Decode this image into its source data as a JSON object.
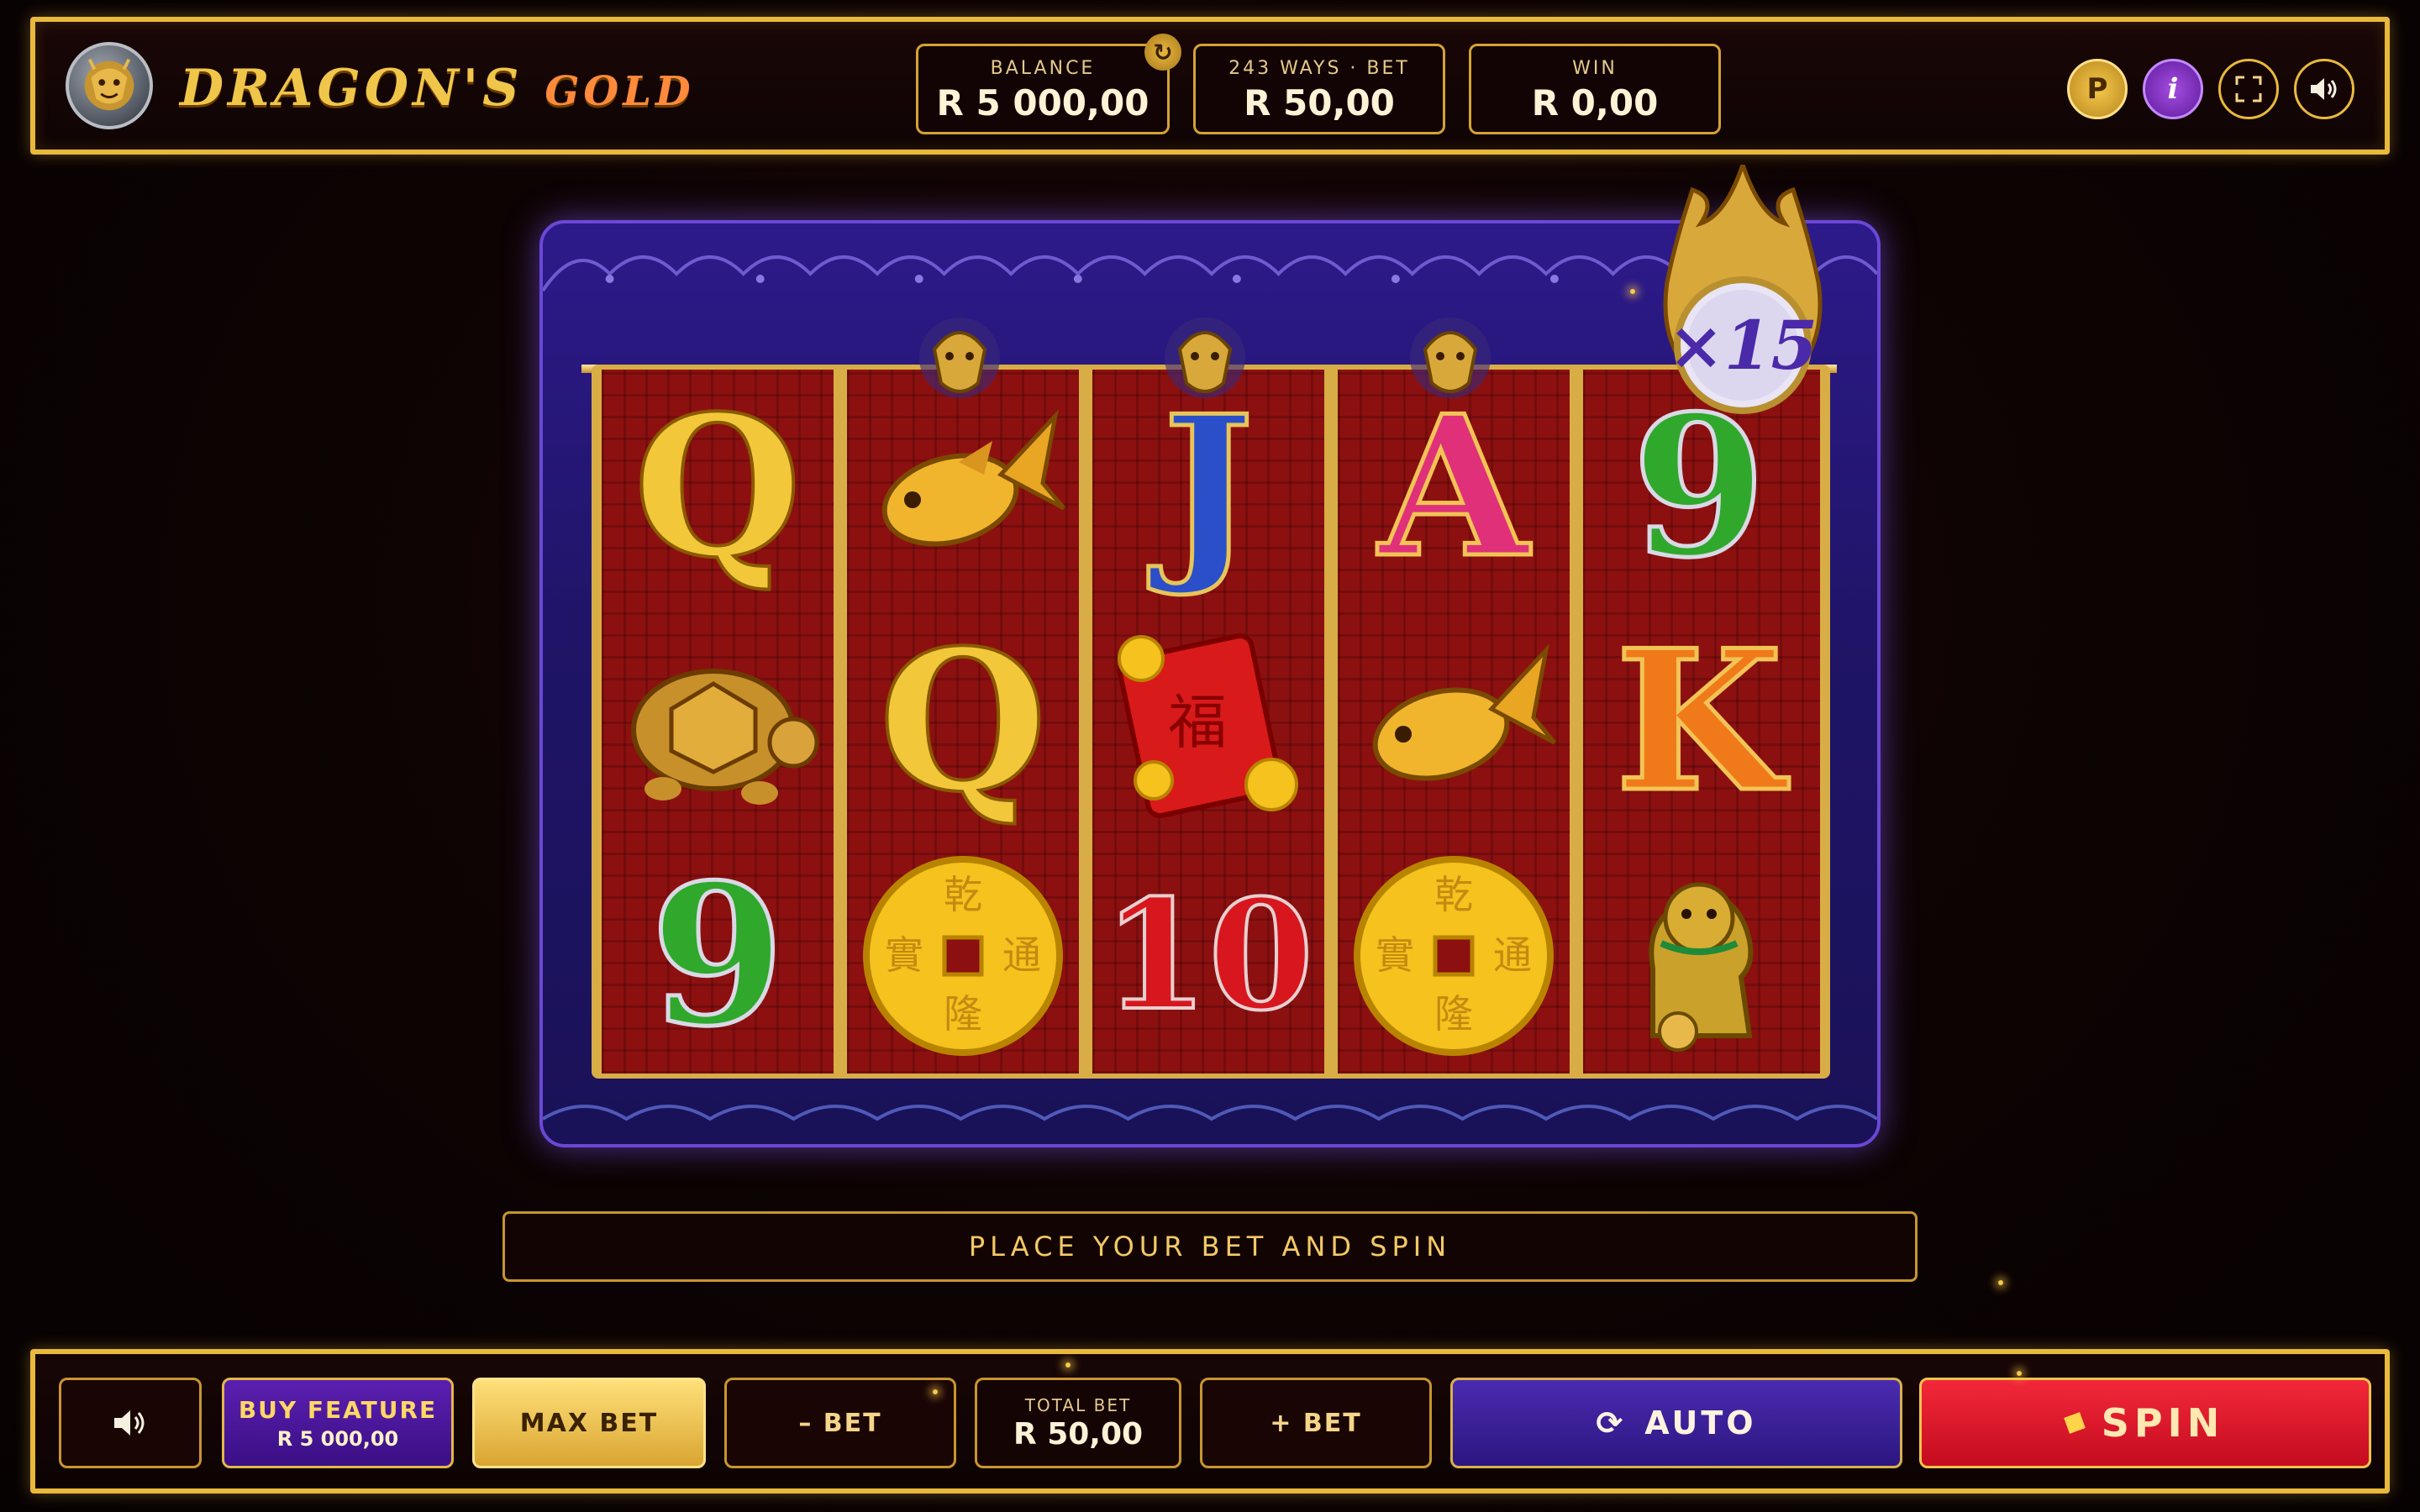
{
  "header": {
    "logo_main": "DRAGON'S",
    "logo_sub": "GOLD",
    "balance_label": "BALANCE",
    "balance_value": "R 5 000,00",
    "bet_label": "243 WAYS · BET",
    "bet_value": "R 50,00",
    "win_label": "WIN",
    "win_value": "R 0,00",
    "refresh_icon": "↻",
    "btn_p": "P",
    "btn_info": "i"
  },
  "reels": {
    "multiplier": "×15",
    "symbols": [
      [
        "Q",
        "turtle",
        "9"
      ],
      [
        "koi-fish",
        "Q",
        "gold-coin"
      ],
      [
        "J",
        "red-envelope",
        "10"
      ],
      [
        "A",
        "koi-fish",
        "gold-coin"
      ],
      [
        "9",
        "K",
        "foo-dog"
      ]
    ],
    "coin_chars": [
      "乾",
      "隆",
      "實",
      "通"
    ]
  },
  "message": "PLACE YOUR BET AND SPIN",
  "controls": {
    "buy_feature_label": "BUY FEATURE",
    "buy_feature_price": "R 5 000,00",
    "max_bet": "MAX BET",
    "minus_bet": "– BET",
    "total_bet_label": "TOTAL BET",
    "total_bet_value": "R 50,00",
    "plus_bet": "+ BET",
    "auto": "AUTO",
    "spin": "SPIN"
  },
  "colors": {
    "gold": "#e9b93c",
    "purple": "#3a1f9a",
    "red": "#e0142a",
    "reel_red": "#8d1010"
  }
}
